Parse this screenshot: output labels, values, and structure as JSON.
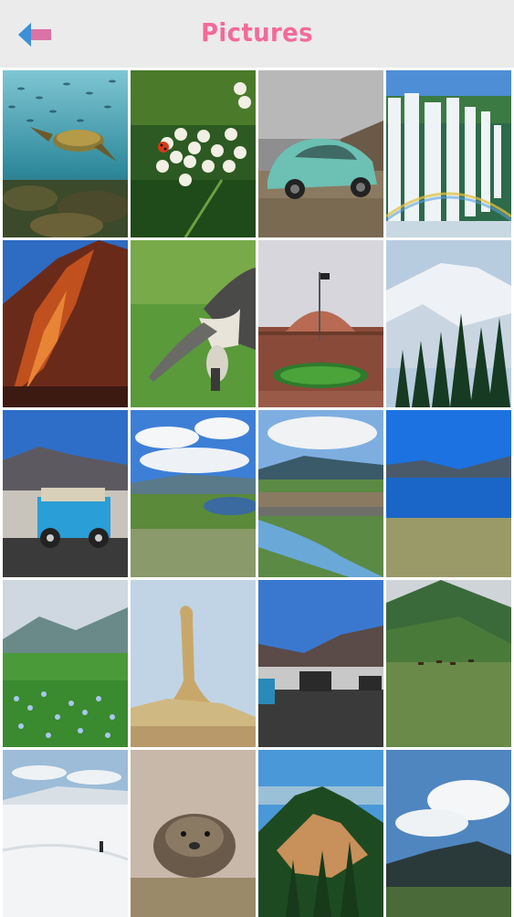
{
  "header": {
    "title": "Pictures",
    "back_icon": "back-arrow-icon",
    "accent_color": "#f36a9a",
    "back_arrow_colors": [
      "#4aa3e8",
      "#f36a9a"
    ]
  },
  "gallery": {
    "columns": 4,
    "photos": [
      {
        "name": "photo-sea-turtle"
      },
      {
        "name": "photo-white-flowers-ladybug"
      },
      {
        "name": "photo-vintage-beetle-car"
      },
      {
        "name": "photo-waterfall-rainbow"
      },
      {
        "name": "photo-red-rock-cliff"
      },
      {
        "name": "photo-anteater"
      },
      {
        "name": "photo-monument-flag"
      },
      {
        "name": "photo-snowy-mountain-forest"
      },
      {
        "name": "photo-jeep-mountains"
      },
      {
        "name": "photo-green-valley-lake"
      },
      {
        "name": "photo-river-plateau"
      },
      {
        "name": "photo-blue-lake"
      },
      {
        "name": "photo-blue-flower-meadow"
      },
      {
        "name": "photo-rock-pillar"
      },
      {
        "name": "photo-jeeps-road"
      },
      {
        "name": "photo-grassland-hills"
      },
      {
        "name": "photo-snow-field-person"
      },
      {
        "name": "photo-marmot"
      },
      {
        "name": "photo-forest-hill"
      },
      {
        "name": "photo-cloudy-mountains"
      }
    ]
  }
}
